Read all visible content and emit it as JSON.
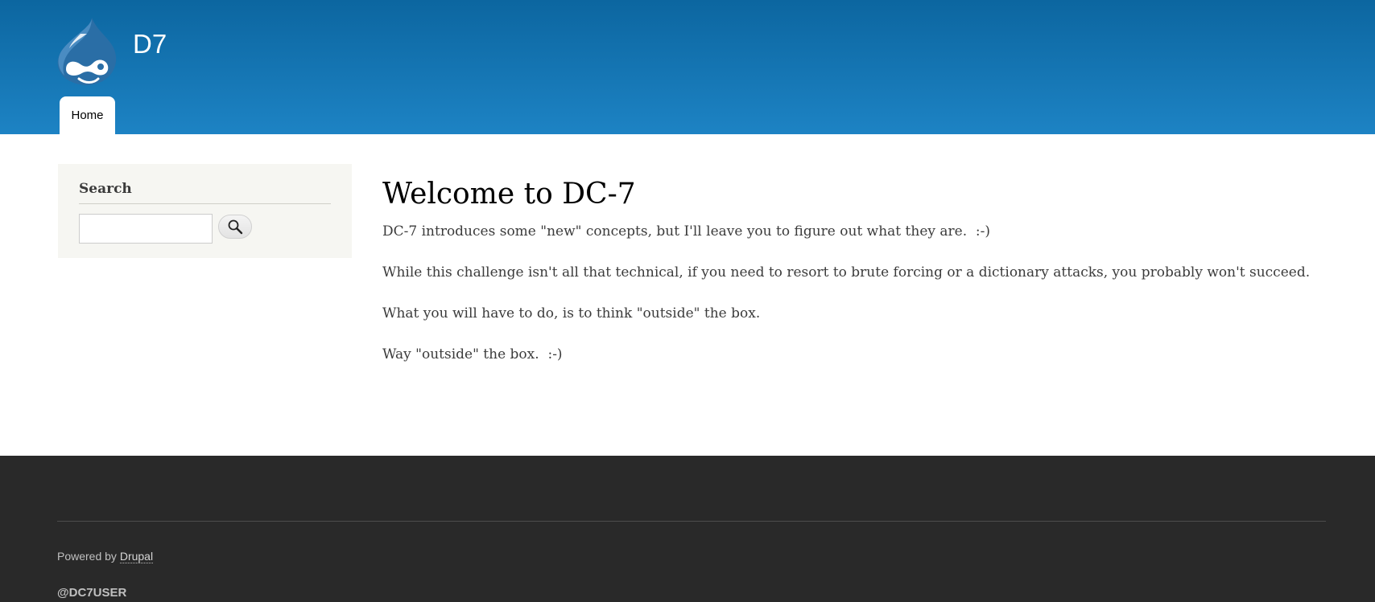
{
  "header": {
    "site_name": "D7",
    "logo_icon": "drupal-drop-icon",
    "menu": [
      {
        "label": "Home"
      }
    ]
  },
  "sidebar": {
    "search_block": {
      "title": "Search",
      "input_value": "",
      "button_icon": "search-icon"
    }
  },
  "content": {
    "title": "Welcome to DC-7",
    "paragraphs": [
      "DC-7 introduces some \"new\" concepts, but I'll leave you to figure out what they are.  :-)",
      "While this challenge isn't all that technical, if you need to resort to brute forcing or a dictionary attacks, you probably won't succeed.",
      "What you will have to do, is to think \"outside\" the box.",
      "Way \"outside\" the box.  :-)"
    ]
  },
  "footer": {
    "powered_prefix": "Powered by",
    "powered_link": "Drupal",
    "handle": "@DC7USER"
  },
  "colors": {
    "header_top": "#0c66a0",
    "header_bottom": "#1d83c4",
    "sidebar_bg": "#f6f6f2",
    "footer_bg": "#292929"
  }
}
